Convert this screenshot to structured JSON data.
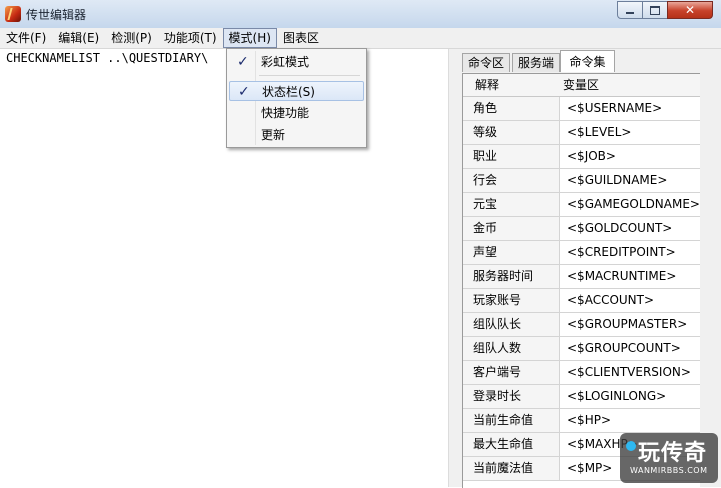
{
  "window": {
    "title": "传世编辑器"
  },
  "menubar": [
    "文件(F)",
    "编辑(E)",
    "检测(P)",
    "功能项(T)",
    "模式(H)",
    "图表区"
  ],
  "dropdown": {
    "items": [
      {
        "label": "彩虹模式",
        "checked": true
      },
      {
        "label": "状态栏(S)",
        "checked": true,
        "highlighted": true
      },
      {
        "label": "快捷功能",
        "checked": false
      },
      {
        "label": "更新",
        "checked": false
      }
    ],
    "check_glyph": "✓"
  },
  "editor": {
    "text": "CHECKNAMELIST ..\\QUESTDIARY\\"
  },
  "panel": {
    "tabs": [
      "命令区",
      "服务端",
      "命令集"
    ],
    "active_tab": "命令集",
    "columns": [
      "解释",
      "变量区"
    ],
    "rows": [
      [
        "角色",
        "<$USERNAME>"
      ],
      [
        "等级",
        "<$LEVEL>"
      ],
      [
        "职业",
        "<$JOB>"
      ],
      [
        "行会",
        "<$GUILDNAME>"
      ],
      [
        "元宝",
        "<$GAMEGOLDNAME>"
      ],
      [
        "金币",
        "<$GOLDCOUNT>"
      ],
      [
        "声望",
        "<$CREDITPOINT>"
      ],
      [
        "服务器时间",
        "<$MACRUNTIME>"
      ],
      [
        "玩家账号",
        "<$ACCOUNT>"
      ],
      [
        "组队队长",
        "<$GROUPMASTER>"
      ],
      [
        "组队人数",
        "<$GROUPCOUNT>"
      ],
      [
        "客户端号",
        "<$CLIENTVERSION>"
      ],
      [
        "登录时长",
        "<$LOGINLONG>"
      ],
      [
        "当前生命值",
        "<$HP>"
      ],
      [
        "最大生命值",
        "<$MAXHP>"
      ],
      [
        "当前魔法值",
        "<$MP>"
      ]
    ]
  },
  "watermark": {
    "main": "玩传奇",
    "sub": "WANMIRBBS.COM"
  }
}
